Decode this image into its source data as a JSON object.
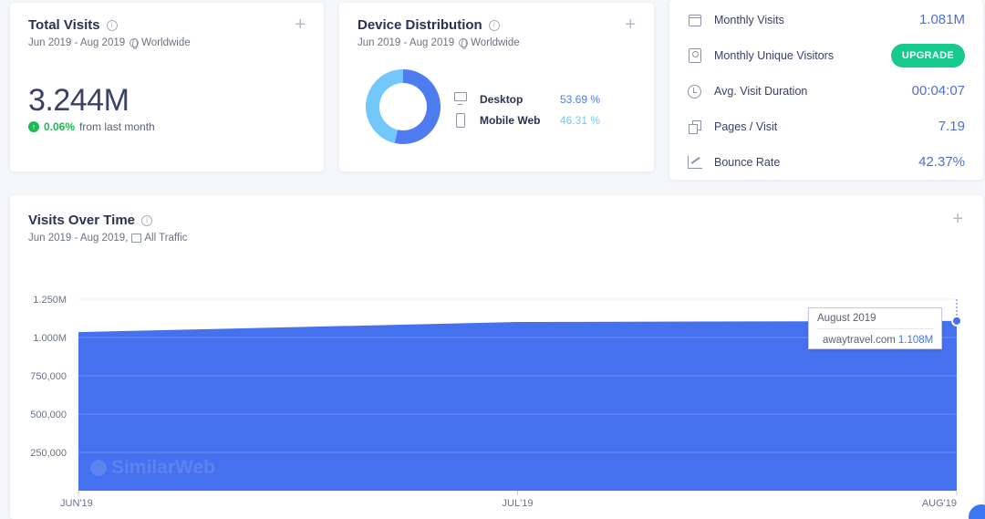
{
  "total_visits": {
    "title": "Total Visits",
    "subtitle": "Jun 2019 - Aug 2019",
    "region": "Worldwide",
    "value": "3.244M",
    "change_value": "0.06%",
    "change_label": "from last month",
    "change_color": "#1db954"
  },
  "device_distribution": {
    "title": "Device Distribution",
    "subtitle": "Jun 2019 - Aug 2019",
    "region": "Worldwide",
    "devices": [
      {
        "name": "Desktop",
        "value": "53.69 %",
        "share": 53.69,
        "color": "#4e7cf0",
        "icon": "desktop-icon"
      },
      {
        "name": "Mobile Web",
        "value": "46.31 %",
        "share": 46.31,
        "color": "#72c7fb",
        "icon": "mobile-icon"
      }
    ]
  },
  "metrics": {
    "items": [
      {
        "label": "Monthly Visits",
        "value": "1.081M",
        "icon": "calendar-icon"
      },
      {
        "label": "Monthly Unique Visitors",
        "button": "UPGRADE",
        "icon": "user-card-icon"
      },
      {
        "label": "Avg. Visit Duration",
        "value": "00:04:07",
        "icon": "clock-icon"
      },
      {
        "label": "Pages / Visit",
        "value": "7.19",
        "icon": "pages-icon"
      },
      {
        "label": "Bounce Rate",
        "value": "42.37%",
        "icon": "bounce-icon"
      }
    ]
  },
  "visits_over_time": {
    "title": "Visits Over Time",
    "subtitle": "Jun 2019 - Aug 2019,",
    "traffic": "All Traffic",
    "watermark": "SimilarWeb",
    "tooltip": {
      "title": "August 2019",
      "site": "awaytravel.com",
      "value": "1.108M"
    }
  },
  "chart_data": {
    "type": "area",
    "categories": [
      "JUN'19",
      "JUL'19",
      "AUG'19"
    ],
    "series": [
      {
        "name": "awaytravel.com",
        "values": [
          1035000,
          1101000,
          1108000
        ],
        "color": "#4571ee"
      }
    ],
    "y_ticks": [
      250000,
      500000,
      750000,
      1000000,
      1250000
    ],
    "y_tick_labels": [
      "250,000",
      "500,000",
      "750,000",
      "1.000M",
      "1.250M"
    ],
    "ylim": [
      0,
      1250000
    ],
    "grid": true,
    "xlabel": "",
    "ylabel": ""
  }
}
